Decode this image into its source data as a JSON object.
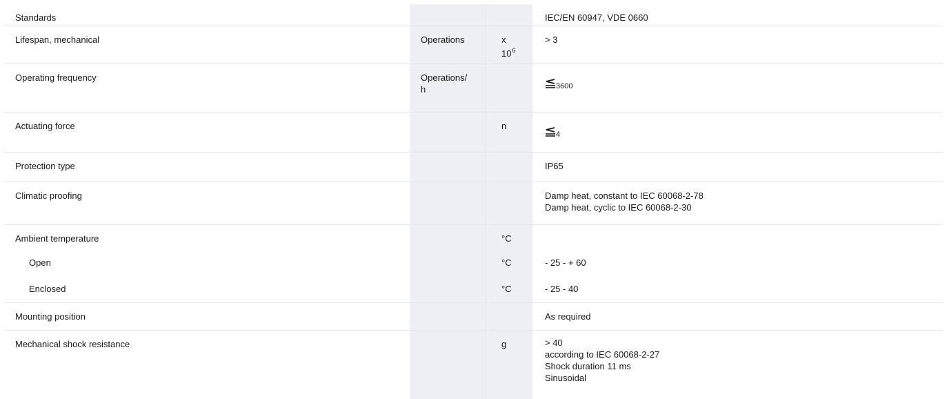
{
  "rows": [
    {
      "label": "Standards",
      "unit1": "",
      "unit2": "",
      "value_lines": [
        "IEC/EN 60947, VDE 0660"
      ]
    },
    {
      "label": "Lifespan, mechanical",
      "unit1": "Operations",
      "unit2_base_line1": "x",
      "unit2_base_line2": "10",
      "unit2_sup": "6",
      "value_lines": [
        "> 3"
      ]
    },
    {
      "label": "Operating frequency",
      "unit1_lines": [
        "Operations/",
        "h"
      ],
      "unit2": "",
      "value_icon": "less-than-or-equal-icon",
      "value_sub": "3600"
    },
    {
      "label": "Actuating force",
      "unit1": "",
      "unit2": "n",
      "value_icon": "less-than-or-equal-icon",
      "value_sub": "4"
    },
    {
      "label": "Protection type",
      "unit1": "",
      "unit2": "",
      "value_lines": [
        "IP65"
      ]
    },
    {
      "label": "Climatic proofing",
      "unit1": "",
      "unit2": "",
      "value_lines": [
        "Damp heat, constant to IEC 60068-2-78",
        "Damp heat, cyclic to IEC 60068-2-30"
      ]
    },
    {
      "label": "Ambient temperature",
      "unit1": "",
      "unit2": "°C",
      "value_lines": [
        ""
      ]
    },
    {
      "label": "Open",
      "unit1": "",
      "unit2": "°C",
      "value_lines": [
        "- 25 - + 60"
      ]
    },
    {
      "label": "Enclosed",
      "unit1": "",
      "unit2": "°C",
      "value_lines": [
        "- 25 - 40"
      ]
    },
    {
      "label": "Mounting position",
      "unit1": "",
      "unit2": "",
      "value_lines": [
        "As required"
      ]
    },
    {
      "label": "Mechanical shock resistance",
      "unit1": "",
      "unit2": "g",
      "value_lines": [
        "> 40",
        "according to IEC 60068-2-27",
        "Shock duration 11 ms",
        "Sinusoidal"
      ]
    }
  ],
  "theme": {
    "band_color": "#eef0f5",
    "rule_color": "#e4e6ea",
    "text_color": "#1a1a1a"
  }
}
